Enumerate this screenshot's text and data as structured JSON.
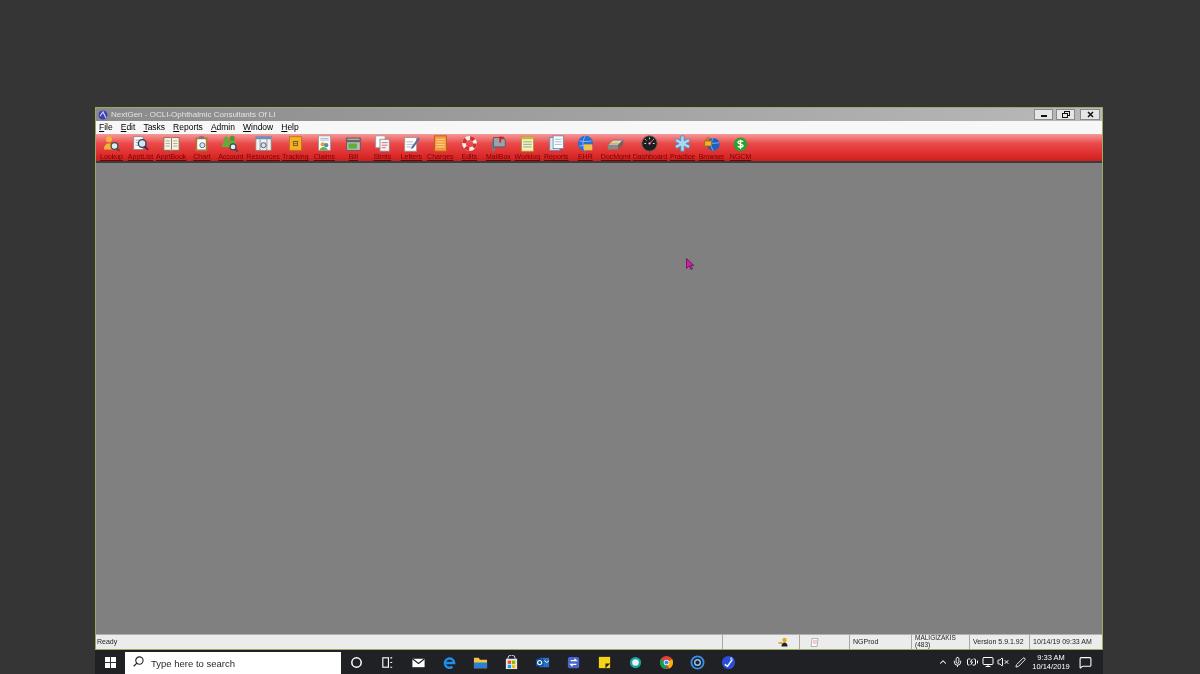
{
  "window": {
    "title": "NextGen - OCLI-Ophthalmic Consultants Of LI"
  },
  "menu": [
    "File",
    "Edit",
    "Tasks",
    "Reports",
    "Admin",
    "Window",
    "Help"
  ],
  "toolbar": [
    "Lookup",
    "ApptList",
    "ApptBook",
    "Chart",
    "Account",
    "Resources",
    "Tracking",
    "Claims",
    "Bill",
    "Stmts",
    "Letters",
    "Charges",
    "Edits",
    "MailBox",
    "Worklog",
    "Reports",
    "EHR",
    "DocMgmt",
    "Dashboard",
    "Practice",
    "Browser",
    "NGCM"
  ],
  "status_bar": {
    "message": "Ready",
    "server": "NGProd",
    "user": [
      "MALIGIZAKIS",
      "(483)"
    ],
    "version": "Version 5.9.1.92",
    "datetime": "10/14/19 09:33 AM"
  },
  "taskbar": {
    "search": {
      "placeholder": "Type here to search"
    },
    "clock": {
      "time": "9:33 AM",
      "date": "10/14/2019"
    }
  }
}
